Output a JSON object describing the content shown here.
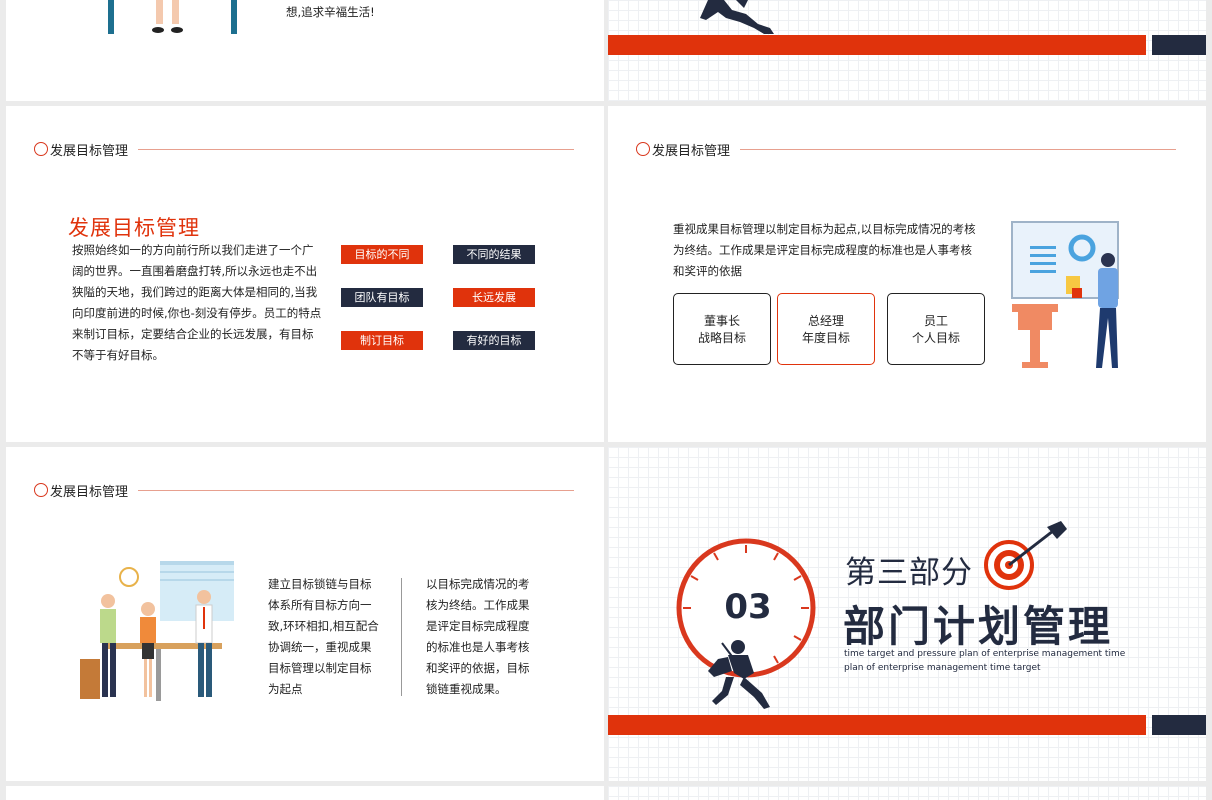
{
  "slide1": {
    "tail_text": "想,追求辛福生活!"
  },
  "section_header": "发展目标管理",
  "slide3": {
    "title": "发展目标管理",
    "body_lines": [
      "按照始终如一的方向前行所以我们走进了一个广",
      "阔的世界。一直围着磨盘打转,所以永远也走不出",
      "狭隘的天地，我们跨过的距离大体是相同的,当我",
      "向印度前进的时候,你也-刻没有停步。员工的特点",
      "来制订目标，定要结合企业的长远发展，有目标",
      "不等于有好目标。"
    ],
    "tags": [
      "目标的不同",
      "不同的结果",
      "团队有目标",
      "长远发展",
      "制订目标",
      "有好的目标"
    ]
  },
  "slide4": {
    "body_lines": [
      "重视成果目标管理以制定目标为起点,以目标完成情况的考核",
      "为终结。工作成果是评定目标完成程度的标准也是人事考核",
      "和奖评的依据"
    ],
    "boxes": [
      {
        "line1": "董事长",
        "line2": "战略目标"
      },
      {
        "line1": "总经理",
        "line2": "年度目标"
      },
      {
        "line1": "员工",
        "line2": "个人目标"
      }
    ]
  },
  "slide5": {
    "col1_lines": [
      "建立目标锁链与目标",
      "体系所有目标方向一",
      "致,环环相扣,相互配合",
      "协调统一，重视成果",
      "目标管理以制定目标",
      "为起点"
    ],
    "col2_lines": [
      "以目标完成情况的考",
      "核为终结。工作成果",
      "是评定目标完成程度",
      "的标准也是人事考核",
      "和奖评的依据，目标",
      "锁链重视成果。"
    ]
  },
  "slide6": {
    "number": "03",
    "part_label": "第三部分",
    "title": "部门计划管理",
    "subtitle_lines": [
      "time target and pressure plan of enterprise management time",
      "plan of enterprise management time target"
    ]
  },
  "colors": {
    "accent": "#e0330c",
    "navy": "#232b40"
  }
}
